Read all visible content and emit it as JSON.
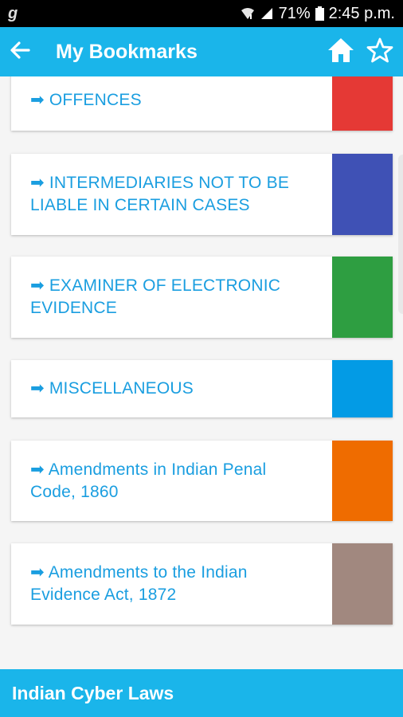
{
  "status_bar": {
    "app_badge": "g",
    "battery": "71%",
    "time": "2:45 p.m."
  },
  "app_bar": {
    "title": "My Bookmarks"
  },
  "bookmarks": [
    {
      "arrow": "➡",
      "label": "OFFENCES",
      "color": "#e53935"
    },
    {
      "arrow": "➡",
      "label": "INTERMEDIARIES NOT TO BE LIABLE IN CERTAIN CASES",
      "color": "#3f51b5"
    },
    {
      "arrow": "➡",
      "label": "EXAMINER OF ELECTRONIC EVIDENCE",
      "color": "#2e9e41"
    },
    {
      "arrow": "➡",
      "label": "MISCELLANEOUS",
      "color": "#039be5"
    },
    {
      "arrow": "➡",
      "label": "Amendments in Indian Penal Code, 1860",
      "color": "#ef6c00"
    },
    {
      "arrow": "➡",
      "label": "Amendments to the Indian Evidence Act, 1872",
      "color": "#a1887f"
    }
  ],
  "footer": {
    "title": "Indian Cyber Laws"
  },
  "colors": {
    "accent": "#1ab5ea",
    "link_text": "#1a9ee0"
  }
}
